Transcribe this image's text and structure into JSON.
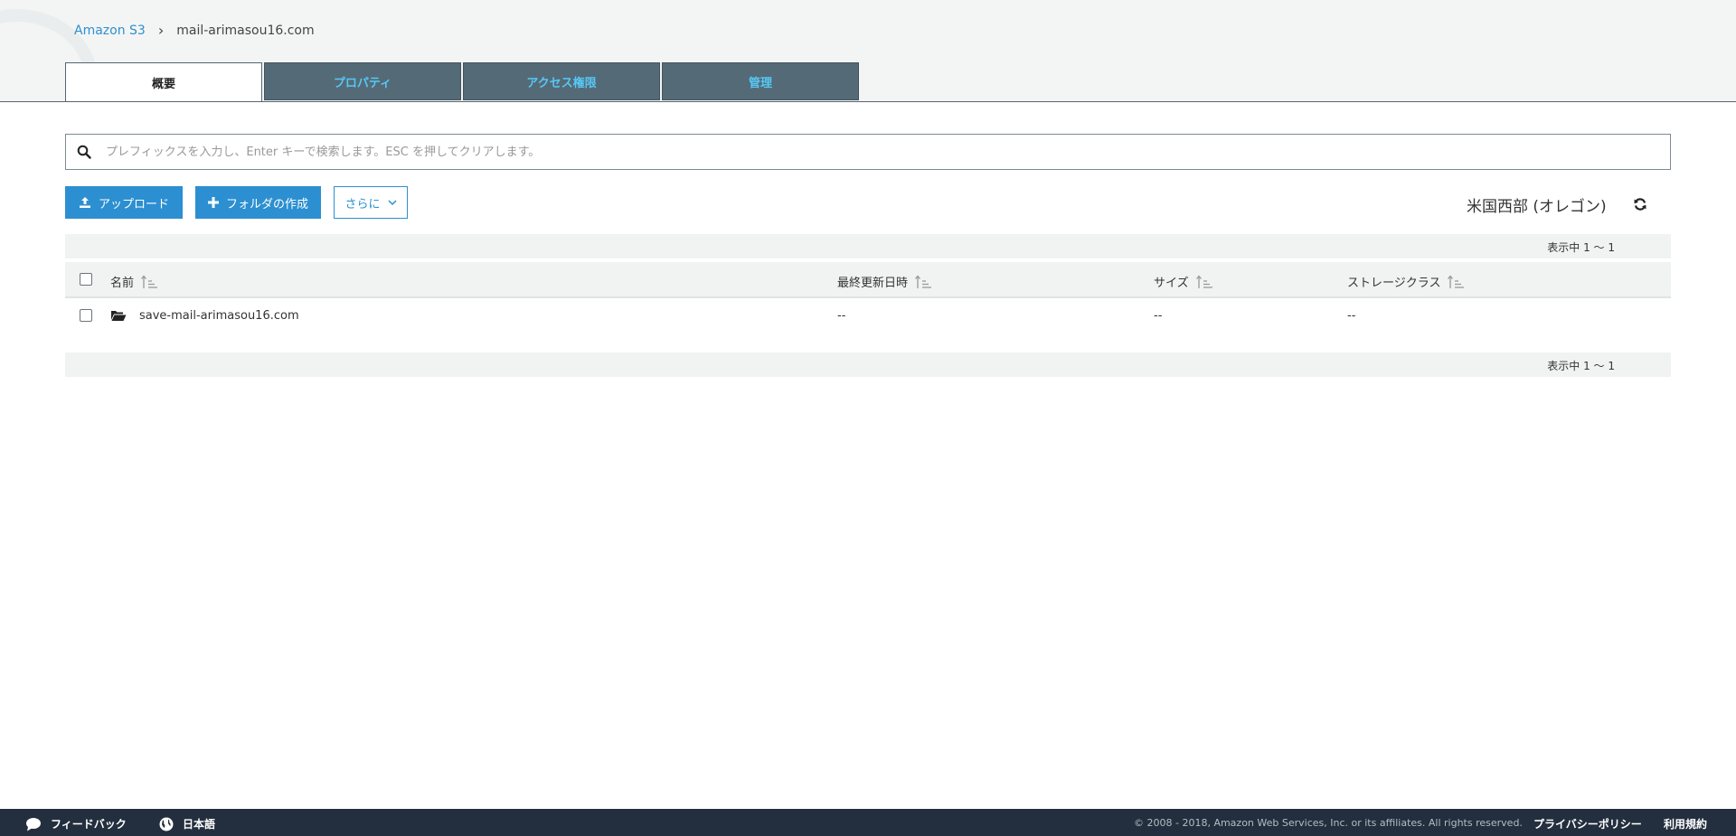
{
  "breadcrumb": {
    "root": "Amazon S3",
    "separator": "›",
    "current": "mail-arimasou16.com"
  },
  "tabs": [
    {
      "label": "概要",
      "active": true
    },
    {
      "label": "プロパティ",
      "active": false
    },
    {
      "label": "アクセス権限",
      "active": false
    },
    {
      "label": "管理",
      "active": false
    }
  ],
  "search": {
    "placeholder": "プレフィックスを入力し、Enter キーで検索します。ESC を押してクリアします。",
    "value": ""
  },
  "toolbar": {
    "upload_label": "アップロード",
    "create_folder_label": "フォルダの作成",
    "more_label": "さらに",
    "region_label": "米国西部 (オレゴン)"
  },
  "pager": {
    "top_text": "表示中 1 ～ 1",
    "bottom_text": "表示中 1 ～ 1"
  },
  "table": {
    "columns": [
      "名前",
      "最終更新日時",
      "サイズ",
      "ストレージクラス"
    ],
    "rows": [
      {
        "type": "folder",
        "name": "save-mail-arimasou16.com",
        "last_modified": "--",
        "size": "--",
        "storage_class": "--"
      }
    ]
  },
  "footer": {
    "feedback_label": "フィードバック",
    "language_label": "日本語",
    "copyright": "© 2008 - 2018, Amazon Web Services, Inc. or its affiliates. All rights reserved.",
    "privacy_label": "プライバシーポリシー",
    "terms_label": "利用規約"
  },
  "colors": {
    "accent": "#2c8fd1",
    "tab_bg": "#556a77",
    "tab_text": "#56c8f5",
    "footer_bg": "#232f3e"
  }
}
